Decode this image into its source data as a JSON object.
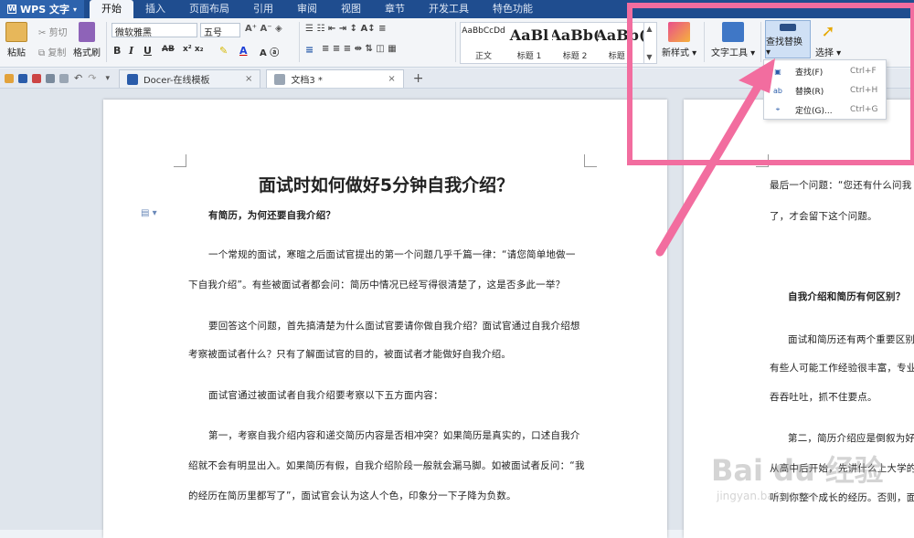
{
  "app": {
    "name": "WPS 文字"
  },
  "menu": [
    "开始",
    "插入",
    "页面布局",
    "引用",
    "审阅",
    "视图",
    "章节",
    "开发工具",
    "特色功能"
  ],
  "menu_active": 0,
  "ribbon": {
    "paste": "粘贴",
    "cut": "剪切",
    "copy": "复制",
    "format_painter": "格式刷",
    "font_name": "微软雅黑",
    "font_size": "五号",
    "styles": [
      {
        "sample": "AaBbCcDd",
        "label": "正文"
      },
      {
        "sample": "AaBl",
        "label": "标题 1"
      },
      {
        "sample": "AaBb(",
        "label": "标题 2"
      },
      {
        "sample": "AaBb(",
        "label": "标题 3"
      }
    ],
    "new_style": "新样式",
    "text_tools": "文字工具",
    "find_replace": "查找替换",
    "select": "选择"
  },
  "tabs": [
    {
      "label": "Docer-在线模板",
      "active": false
    },
    {
      "label": "文档3 *",
      "active": true
    }
  ],
  "dropdown": [
    {
      "label": "查找(F)",
      "shortcut": "Ctrl+F",
      "icon": "binoculars-icon"
    },
    {
      "label": "替换(R)",
      "shortcut": "Ctrl+H",
      "icon": "replace-icon"
    },
    {
      "label": "定位(G)...",
      "shortcut": "Ctrl+G",
      "icon": "goto-icon"
    }
  ],
  "doc": {
    "title": "面试时如何做好5分钟自我介绍？",
    "lines": [
      {
        "text": "有简历，为何还要自我介绍？",
        "bold": true
      },
      {
        "text": "一个常规的面试，寒暄之后面试官提出的第一个问题几乎千篇一律：“请您简单地做一",
        "bold": false
      },
      {
        "text": "下自我介绍”。有些被面试者都会问：简历中情况已经写得很清楚了，这是否多此一举？",
        "bold": false
      },
      {
        "text": "要回答这个问题，首先搞清楚为什么面试官要请你做自我介绍？面试官通过自我介绍想",
        "bold": false
      },
      {
        "text": "考察被面试者什么？只有了解面试官的目的，被面试者才能做好自我介绍。",
        "bold": false
      },
      {
        "text": "面试官通过被面试者自我介绍要考察以下五方面内容：",
        "bold": false
      },
      {
        "text": "第一，考察自我介绍内容和递交简历内容是否相冲突？如果简历是真实的，口述自我介",
        "bold": false
      },
      {
        "text": "绍就不会有明显出入。如果简历有假，自我介绍阶段一般就会漏马脚。如被面试者反问：“我",
        "bold": false
      },
      {
        "text": "的经历在简历里都写了”，面试官会认为这人个色，印象分一下子降为负数。",
        "bold": false
      }
    ],
    "right_lines": [
      {
        "text": "最后一个问题：“您还有什么问我",
        "bold": false
      },
      {
        "text": "了，才会留下这个问题。",
        "bold": false
      },
      {
        "text": "自我介绍和简历有何区别？",
        "bold": true
      },
      {
        "text": "面试和简历还有两个重要区别",
        "bold": false
      },
      {
        "text": "有些人可能工作经验很丰富，专业",
        "bold": false
      },
      {
        "text": "吞吞吐吐，抓不住要点。",
        "bold": false
      },
      {
        "text": "第二，简历介绍应是倒叙为好",
        "bold": false
      },
      {
        "text": "从高中后开始，先讲什么上大学的教育",
        "bold": false
      },
      {
        "text": "听到你整个成长的经历。否则，面",
        "bold": false
      }
    ]
  },
  "watermark": {
    "brand": "Bai du 经验",
    "url": "jingyan.baidu.com"
  },
  "colors": {
    "titlebar": "#1f4d8f",
    "accent": "#f26d9f"
  }
}
